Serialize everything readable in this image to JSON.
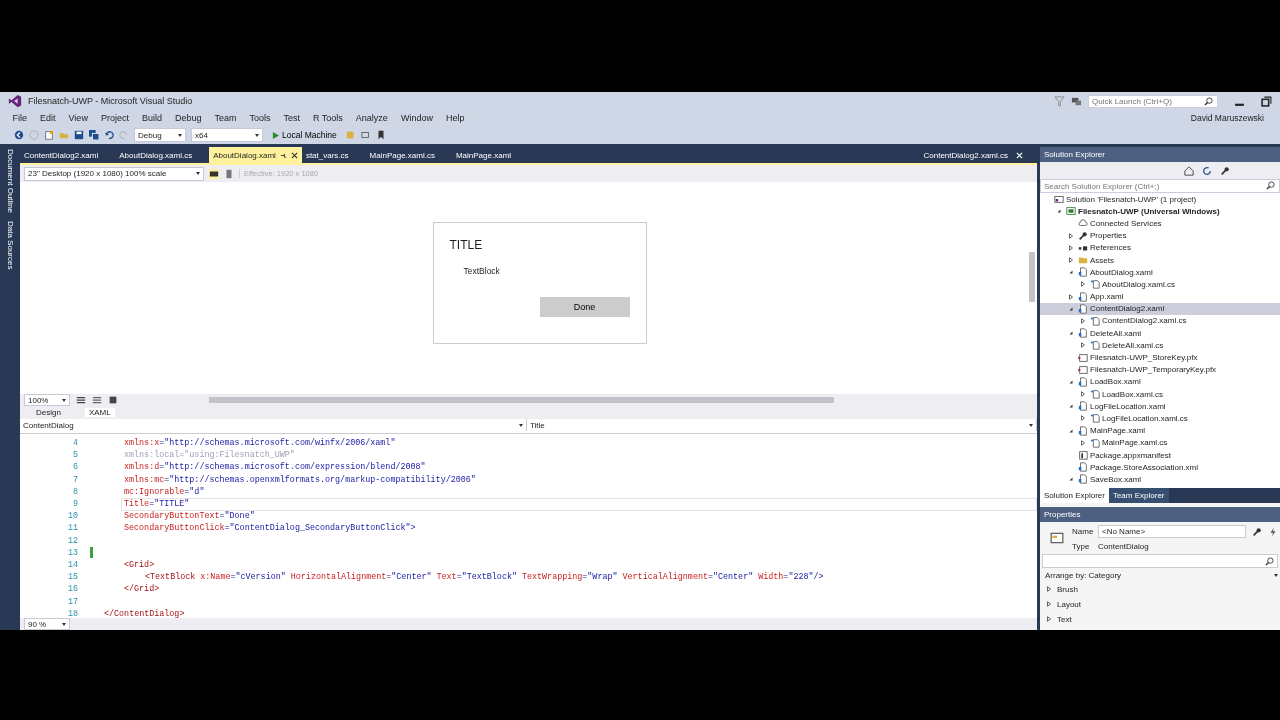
{
  "window": {
    "title": "Filesnatch-UWP - Microsoft Visual Studio",
    "quick_launch": {
      "placeholder": "Quick Launch (Ctrl+Q)"
    },
    "user": "David Maruszewski"
  },
  "menu": [
    "File",
    "Edit",
    "View",
    "Project",
    "Build",
    "Debug",
    "Team",
    "Tools",
    "Test",
    "R Tools",
    "Analyze",
    "Window",
    "Help"
  ],
  "toolbar": {
    "configuration": "Debug",
    "platform": "x64",
    "run_target": "Local Machine"
  },
  "side_tabs": [
    "Document Outline",
    "Data Sources"
  ],
  "document_tabs": [
    {
      "label": "ContentDialog2.xaml",
      "selected": false
    },
    {
      "label": "AboutDialog.xaml.cs",
      "selected": false
    },
    {
      "label": "AboutDialog.xaml",
      "selected": true
    },
    {
      "label": "stat_vars.cs",
      "selected": false
    },
    {
      "label": "MainPage.xaml.cs",
      "selected": false
    },
    {
      "label": "MainPage.xaml",
      "selected": false
    }
  ],
  "preview_tab": "ContentDialog2.xaml.cs",
  "designer": {
    "device": "23\" Desktop (1920 x 1080) 100% scale",
    "effective": "Effective: 1920 x 1080",
    "zoom": "100%",
    "dialog": {
      "title": "TITLE",
      "text": "TextBlock",
      "button": "Done"
    }
  },
  "view_tabs": [
    {
      "label": "Design",
      "selected": false
    },
    {
      "label": "XAML",
      "selected": true
    }
  ],
  "breadcrumb": "ContentDialog",
  "member": "Title",
  "code_lines": [
    {
      "num": "4",
      "current": false,
      "modified": false,
      "tokens": [
        {
          "kind": "attr",
          "text": "xmlns:x"
        },
        {
          "kind": "value",
          "text": "=\"http://schemas.microsoft.com/winfx/2006/xaml\""
        }
      ]
    },
    {
      "num": "5",
      "current": false,
      "modified": false,
      "tokens": [
        {
          "kind": "dim",
          "text": "xmlns:local=\"using:Filesnatch_UWP\""
        }
      ]
    },
    {
      "num": "6",
      "current": false,
      "modified": false,
      "tokens": [
        {
          "kind": "attr",
          "text": "xmlns:d"
        },
        {
          "kind": "value",
          "text": "=\"http://schemas.microsoft.com/expression/blend/2008\""
        }
      ]
    },
    {
      "num": "7",
      "current": false,
      "modified": false,
      "tokens": [
        {
          "kind": "attr",
          "text": "xmlns:mc"
        },
        {
          "kind": "value",
          "text": "=\"http://schemas.openxmlformats.org/markup-compatibility/2006\""
        }
      ]
    },
    {
      "num": "8",
      "current": false,
      "modified": false,
      "tokens": [
        {
          "kind": "attr",
          "text": "mc:Ignorable"
        },
        {
          "kind": "value",
          "text": "=\"d\""
        }
      ]
    },
    {
      "num": "9",
      "current": true,
      "modified": false,
      "tokens": [
        {
          "kind": "attr",
          "text": "Title"
        },
        {
          "kind": "value",
          "text": "=\"TITLE\""
        }
      ]
    },
    {
      "num": "10",
      "current": false,
      "modified": false,
      "tokens": [
        {
          "kind": "attr",
          "text": "SecondaryButtonText"
        },
        {
          "kind": "value",
          "text": "=\"Done\""
        }
      ]
    },
    {
      "num": "11",
      "current": false,
      "modified": false,
      "tokens": [
        {
          "kind": "attr",
          "text": "SecondaryButtonClick"
        },
        {
          "kind": "value",
          "text": "=\"ContentDialog_SecondaryButtonClick\">"
        }
      ]
    },
    {
      "num": "12",
      "current": false,
      "modified": false
    },
    {
      "num": "13",
      "current": false,
      "modified": true
    },
    {
      "num": "14",
      "current": false,
      "modified": false,
      "tokens": [
        {
          "kind": "tag",
          "text": "<Grid>"
        }
      ]
    },
    {
      "num": "15",
      "current": false,
      "modified": false,
      "indent": true,
      "tokens": [
        {
          "kind": "tag",
          "text": "<TextBlock"
        },
        {
          "kind": "attr",
          "text": " x:Name"
        },
        {
          "kind": "value",
          "text": "=\"cVersion\""
        },
        {
          "kind": "attr",
          "text": " HorizontalAlignment"
        },
        {
          "kind": "value",
          "text": "=\"Center\""
        },
        {
          "kind": "attr",
          "text": " Text"
        },
        {
          "kind": "value",
          "text": "=\"TextBlock\""
        },
        {
          "kind": "attr",
          "text": " TextWrapping"
        },
        {
          "kind": "value",
          "text": "=\"Wrap\""
        },
        {
          "kind": "attr",
          "text": " VerticalAlignment"
        },
        {
          "kind": "value",
          "text": "=\"Center\""
        },
        {
          "kind": "attr",
          "text": " Width"
        },
        {
          "kind": "value",
          "text": "=\"228\"/>"
        }
      ]
    },
    {
      "num": "16",
      "current": false,
      "modified": false,
      "tokens": [
        {
          "kind": "tag",
          "text": "</Grid>"
        }
      ]
    },
    {
      "num": "17",
      "current": false,
      "modified": false
    },
    {
      "num": "18",
      "current": false,
      "modified": false,
      "outdent": true,
      "tokens": [
        {
          "kind": "tag",
          "text": "</ContentDialog>"
        }
      ]
    }
  ],
  "editor_zoom": "90 %",
  "solution_explorer": {
    "title": "Solution Explorer",
    "search": {
      "placeholder": "Search Solution Explorer (Ctrl+;)"
    },
    "tree": [
      {
        "label": "Solution 'Filesnatch-UWP' (1 project)",
        "kind": "solution",
        "selected": false,
        "children": [
          {
            "label": "Filesnatch-UWP (Universal Windows)",
            "kind": "project",
            "bold": true,
            "expanded": true,
            "selected": false,
            "children": [
              {
                "label": "Connected Services",
                "kind": "cloud",
                "selected": false
              },
              {
                "label": "Properties",
                "kind": "wrench",
                "expanded": false,
                "selected": false
              },
              {
                "label": "References",
                "kind": "references",
                "expanded": false,
                "selected": false
              },
              {
                "label": "Assets",
                "kind": "folder",
                "expanded": false,
                "selected": false
              },
              {
                "label": "AboutDialog.xaml",
                "kind": "xaml",
                "expanded": true,
                "selected": false,
                "children": [
                  {
                    "label": "AboutDialog.xaml.cs",
                    "kind": "cs",
                    "expanded": false,
                    "selected": false
                  }
                ]
              },
              {
                "label": "App.xaml",
                "kind": "xaml",
                "expanded": false,
                "selected": false
              },
              {
                "label": "ContentDialog2.xaml",
                "kind": "xaml",
                "expanded": true,
                "selected": true,
                "children": [
                  {
                    "label": "ContentDialog2.xaml.cs",
                    "kind": "cs",
                    "expanded": false,
                    "selected": false
                  }
                ]
              },
              {
                "label": "DeleteAll.xaml",
                "kind": "xaml",
                "expanded": true,
                "selected": false,
                "children": [
                  {
                    "label": "DeleteAll.xaml.cs",
                    "kind": "cs",
                    "expanded": false,
                    "selected": false
                  }
                ]
              },
              {
                "label": "Filesnatch-UWP_StoreKey.pfx",
                "kind": "cert",
                "selected": false
              },
              {
                "label": "Filesnatch-UWP_TemporaryKey.pfx",
                "kind": "cert",
                "selected": false
              },
              {
                "label": "LoadBox.xaml",
                "kind": "xaml",
                "expanded": true,
                "selected": false,
                "children": [
                  {
                    "label": "LoadBox.xaml.cs",
                    "kind": "cs",
                    "expanded": false,
                    "selected": false
                  }
                ]
              },
              {
                "label": "LogFileLocation.xaml",
                "kind": "xaml",
                "expanded": true,
                "selected": false,
                "children": [
                  {
                    "label": "LogFileLocation.xaml.cs",
                    "kind": "cs",
                    "expanded": false,
                    "selected": false
                  }
                ]
              },
              {
                "label": "MainPage.xaml",
                "kind": "xaml",
                "expanded": true,
                "selected": false,
                "children": [
                  {
                    "label": "MainPage.xaml.cs",
                    "kind": "cs",
                    "expanded": false,
                    "selected": false
                  }
                ]
              },
              {
                "label": "Package.appxmanifest",
                "kind": "manifest",
                "selected": false
              },
              {
                "label": "Package.StoreAssociation.xml",
                "kind": "xaml",
                "selected": false
              },
              {
                "label": "SaveBox.xaml",
                "kind": "xaml",
                "expanded": true,
                "selected": false
              }
            ]
          }
        ]
      }
    ]
  },
  "panel_tabs": [
    {
      "label": "Solution Explorer",
      "selected": true
    },
    {
      "label": "Team Explorer",
      "selected": false
    }
  ],
  "properties": {
    "title": "Properties",
    "name_label": "Name",
    "name_value": "<No Name>",
    "type_label": "Type",
    "type_value": "ContentDialog",
    "arrange": "Arrange by: Category",
    "categories": [
      {
        "label": "Brush",
        "expanded": false
      },
      {
        "label": "Layout",
        "expanded": false
      },
      {
        "label": "Text",
        "expanded": false
      }
    ]
  }
}
